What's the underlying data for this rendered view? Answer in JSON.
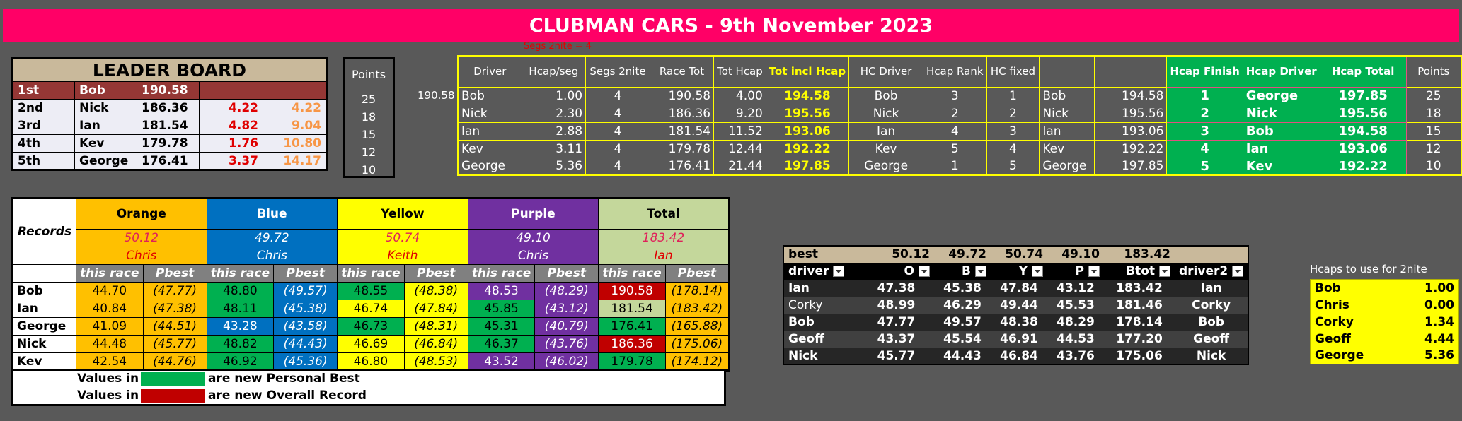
{
  "title": "CLUBMAN CARS - 9th November 2023",
  "segs_note": "Segs 2nite =   4",
  "side_value": "190.58",
  "leaderboard": {
    "header": "LEADER BOARD",
    "points_header": "Points",
    "rows": [
      {
        "pos": "1st",
        "name": "Bob",
        "total": "190.58",
        "diff": "",
        "cum": "",
        "points": "25"
      },
      {
        "pos": "2nd",
        "name": "Nick",
        "total": "186.36",
        "diff": "4.22",
        "cum": "4.22",
        "points": "18"
      },
      {
        "pos": "3rd",
        "name": "Ian",
        "total": "181.54",
        "diff": "4.82",
        "cum": "9.04",
        "points": "15"
      },
      {
        "pos": "4th",
        "name": "Kev",
        "total": "179.78",
        "diff": "1.76",
        "cum": "10.80",
        "points": "12"
      },
      {
        "pos": "5th",
        "name": "George",
        "total": "176.41",
        "diff": "3.37",
        "cum": "14.17",
        "points": "10"
      }
    ]
  },
  "race": {
    "headers": [
      "Driver",
      "Hcap/seg",
      "Segs 2nite",
      "Race Tot",
      "Tot Hcap",
      "Tot incl Hcap",
      "HC Driver",
      "Hcap Rank",
      "HC fixed",
      "",
      "",
      "Hcap Finish",
      "Hcap Driver",
      "Hcap Total",
      "Points"
    ],
    "rows": [
      [
        "Bob",
        "1.00",
        "4",
        "190.58",
        "4.00",
        "194.58",
        "Bob",
        "3",
        "1",
        "Bob",
        "194.58",
        "1",
        "George",
        "197.85",
        "25"
      ],
      [
        "Nick",
        "2.30",
        "4",
        "186.36",
        "9.20",
        "195.56",
        "Nick",
        "2",
        "2",
        "Nick",
        "195.56",
        "2",
        "Nick",
        "195.56",
        "18"
      ],
      [
        "Ian",
        "2.88",
        "4",
        "181.54",
        "11.52",
        "193.06",
        "Ian",
        "4",
        "3",
        "Ian",
        "193.06",
        "3",
        "Bob",
        "194.58",
        "15"
      ],
      [
        "Kev",
        "3.11",
        "4",
        "179.78",
        "12.44",
        "192.22",
        "Kev",
        "5",
        "4",
        "Kev",
        "192.22",
        "4",
        "Ian",
        "193.06",
        "12"
      ],
      [
        "George",
        "5.36",
        "4",
        "176.41",
        "21.44",
        "197.85",
        "George",
        "1",
        "5",
        "George",
        "197.85",
        "5",
        "Kev",
        "192.22",
        "10"
      ]
    ]
  },
  "records": {
    "label": "Records",
    "colours": [
      "Orange",
      "Blue",
      "Yellow",
      "Purple",
      "Total"
    ],
    "record_times": [
      "50.12",
      "49.72",
      "50.74",
      "49.10",
      "183.42"
    ],
    "record_holders": [
      "Chris",
      "Chris",
      "Keith",
      "Chris",
      "Ian"
    ],
    "sub_headers": [
      "this race",
      "Pbest",
      "this race",
      "Pbest",
      "this race",
      "Pbest",
      "this race",
      "Pbest",
      "this race",
      "Pbest"
    ],
    "rows": [
      {
        "name": "Bob",
        "vals": [
          "44.70",
          "(47.77)",
          "48.80",
          "(49.57)",
          "48.55",
          "(48.38)",
          "48.53",
          "(48.29)",
          "190.58",
          "(178.14)"
        ]
      },
      {
        "name": "Ian",
        "vals": [
          "40.84",
          "(47.38)",
          "48.11",
          "(45.38)",
          "46.74",
          "(47.84)",
          "45.85",
          "(43.12)",
          "181.54",
          "(183.42)"
        ]
      },
      {
        "name": "George",
        "vals": [
          "41.09",
          "(44.51)",
          "43.28",
          "(43.58)",
          "46.73",
          "(48.31)",
          "45.31",
          "(40.79)",
          "176.41",
          "(165.88)"
        ]
      },
      {
        "name": "Nick",
        "vals": [
          "44.48",
          "(45.77)",
          "48.82",
          "(44.43)",
          "46.69",
          "(46.84)",
          "46.37",
          "(43.76)",
          "186.36",
          "(175.06)"
        ]
      },
      {
        "name": "Kev",
        "vals": [
          "42.54",
          "(44.76)",
          "46.92",
          "(45.36)",
          "46.80",
          "(48.53)",
          "43.52",
          "(46.02)",
          "179.78",
          "(174.12)"
        ]
      }
    ],
    "legend_prefix": "Values in",
    "legend_pb": "are new Personal Best",
    "legend_or": "are new Overall Record",
    "colors": {
      "pb": "#00b050",
      "record": "#c00000"
    }
  },
  "best": {
    "label": "best",
    "values": [
      "50.12",
      "49.72",
      "50.74",
      "49.10",
      "183.42"
    ],
    "headers": [
      "driver",
      "O",
      "B",
      "Y",
      "P",
      "Btot",
      "driver2"
    ],
    "rows": [
      [
        "Ian",
        "47.38",
        "45.38",
        "47.84",
        "43.12",
        "183.42",
        "Ian"
      ],
      [
        "Corky",
        "48.99",
        "46.29",
        "49.44",
        "45.53",
        "181.46",
        "Corky"
      ],
      [
        "Bob",
        "47.77",
        "49.57",
        "48.38",
        "48.29",
        "178.14",
        "Bob"
      ],
      [
        "Geoff",
        "43.37",
        "45.54",
        "46.91",
        "44.53",
        "177.20",
        "Geoff"
      ],
      [
        "Nick",
        "45.77",
        "44.43",
        "46.84",
        "43.76",
        "175.06",
        "Nick"
      ]
    ]
  },
  "hcaps": {
    "title": "Hcaps to use for 2nite",
    "rows": [
      {
        "name": "Bob",
        "value": "1.00"
      },
      {
        "name": "Chris",
        "value": "0.00"
      },
      {
        "name": "Corky",
        "value": "1.34"
      },
      {
        "name": "Geoff",
        "value": "4.44"
      },
      {
        "name": "George",
        "value": "5.36"
      }
    ]
  }
}
